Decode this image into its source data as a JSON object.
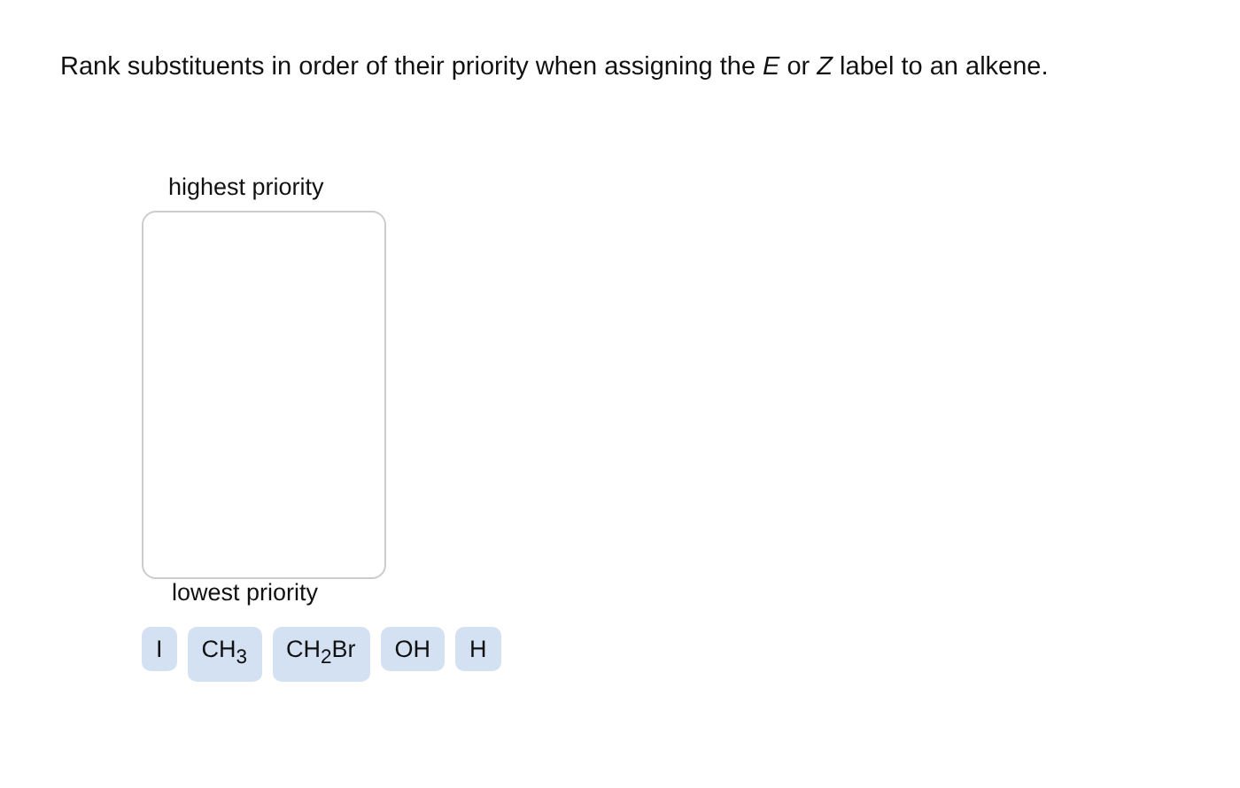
{
  "prompt": "Rank substituents in order of their priority when assigning the *E* or *Z* label to an alkene.",
  "ranking": {
    "top_label": "highest priority",
    "bottom_label": "lowest priority"
  },
  "choices": [
    "I",
    "CH$_{3}$",
    "CH$_{2}$Br",
    "OH",
    "H"
  ]
}
